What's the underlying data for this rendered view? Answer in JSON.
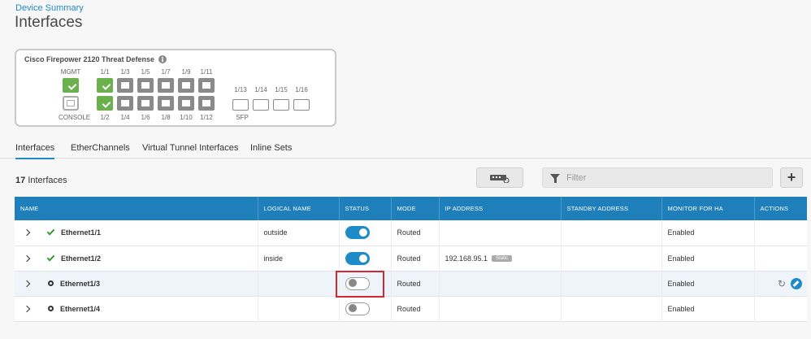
{
  "breadcrumb": "Device Summary",
  "page_title": "Interfaces",
  "device": {
    "title": "Cisco Firepower 2120 Threat Defense",
    "mgmt_label": "MGMT",
    "console_label": "CONSOLE",
    "top_port_labels": [
      "1/1",
      "1/3",
      "1/5",
      "1/7",
      "1/9",
      "1/11"
    ],
    "bottom_port_labels": [
      "1/2",
      "1/4",
      "1/6",
      "1/8",
      "1/10",
      "1/12"
    ],
    "sfp_port_labels": [
      "1/13",
      "1/14",
      "1/15",
      "1/16"
    ],
    "sfp_label": "SFP"
  },
  "tabs": [
    {
      "label": "Interfaces",
      "active": true
    },
    {
      "label": "EtherChannels",
      "active": false
    },
    {
      "label": "Virtual Tunnel Interfaces",
      "active": false
    },
    {
      "label": "Inline Sets",
      "active": false
    }
  ],
  "count": {
    "number": "17",
    "label": "Interfaces"
  },
  "filter": {
    "placeholder": "Filter"
  },
  "table": {
    "headers": [
      "NAME",
      "LOGICAL NAME",
      "STATUS",
      "MODE",
      "IP ADDRESS",
      "STANDBY ADDRESS",
      "MONITOR FOR HA",
      "ACTIONS"
    ],
    "rows": [
      {
        "name": "Ethernet1/1",
        "logical_name": "outside",
        "status_on": true,
        "mode": "Routed",
        "ip": "",
        "ip_badge": "",
        "standby": "",
        "monitor": "Enabled",
        "link_up": true
      },
      {
        "name": "Ethernet1/2",
        "logical_name": "inside",
        "status_on": true,
        "mode": "Routed",
        "ip": "192.168.95.1",
        "ip_badge": "Static",
        "standby": "",
        "monitor": "Enabled",
        "link_up": true
      },
      {
        "name": "Ethernet1/3",
        "logical_name": "",
        "status_on": false,
        "mode": "Routed",
        "ip": "",
        "ip_badge": "",
        "standby": "",
        "monitor": "Enabled",
        "link_up": false
      },
      {
        "name": "Ethernet1/4",
        "logical_name": "",
        "status_on": false,
        "mode": "Routed",
        "ip": "",
        "ip_badge": "",
        "standby": "",
        "monitor": "Enabled",
        "link_up": false
      }
    ]
  },
  "colors": {
    "accent": "#1f8ac8",
    "header_bg": "#1f7fba",
    "link_up": "#6ab04c",
    "highlight": "#d7262f"
  }
}
